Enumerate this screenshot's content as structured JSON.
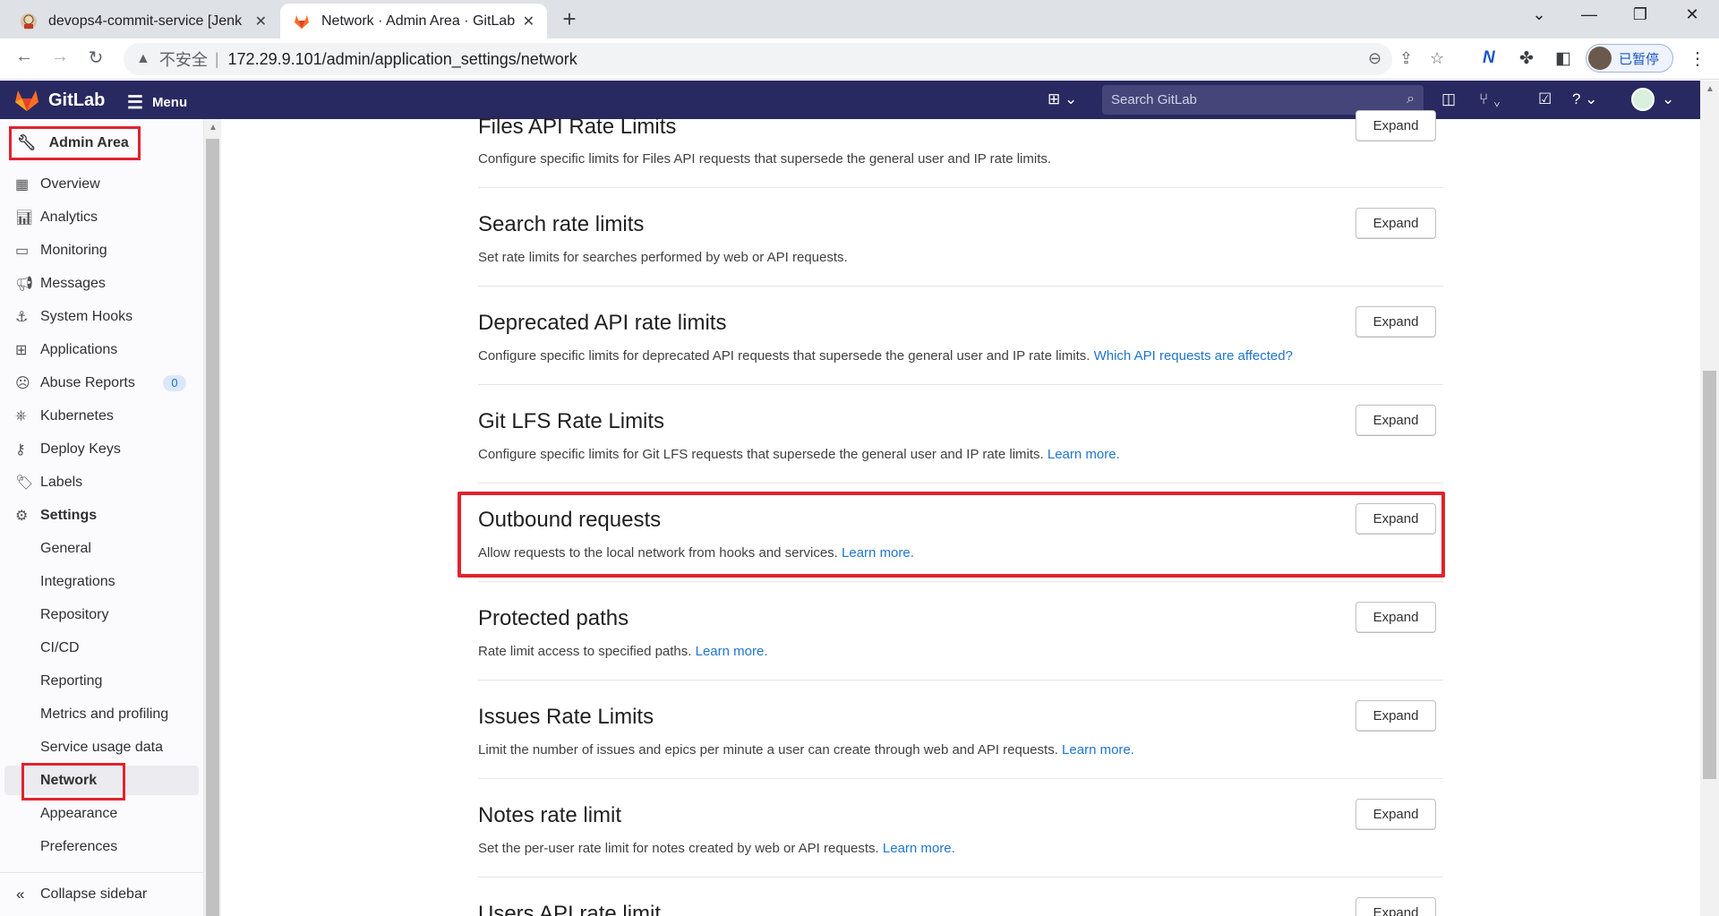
{
  "browser": {
    "tabs": [
      {
        "title": "devops4-commit-service [Jenk",
        "active": false,
        "icon": "jenkins-icon"
      },
      {
        "title": "Network · Admin Area · GitLab",
        "active": true,
        "icon": "gitlab-tanuki-icon"
      }
    ],
    "security_label": "不安全",
    "url": "172.29.9.101/admin/application_settings/network",
    "profile_label": "已暂停"
  },
  "header": {
    "brand": "GitLab",
    "menu_label": "Menu",
    "search_placeholder": "Search GitLab"
  },
  "sidebar": {
    "title": "Admin Area",
    "items": [
      {
        "label": "Overview",
        "icon": "grid-icon"
      },
      {
        "label": "Analytics",
        "icon": "chart-icon"
      },
      {
        "label": "Monitoring",
        "icon": "monitor-icon"
      },
      {
        "label": "Messages",
        "icon": "megaphone-icon"
      },
      {
        "label": "System Hooks",
        "icon": "anchor-icon"
      },
      {
        "label": "Applications",
        "icon": "apps-icon"
      },
      {
        "label": "Abuse Reports",
        "icon": "sad-face-icon",
        "badge": "0"
      },
      {
        "label": "Kubernetes",
        "icon": "kubernetes-icon"
      },
      {
        "label": "Deploy Keys",
        "icon": "key-icon"
      },
      {
        "label": "Labels",
        "icon": "label-icon"
      },
      {
        "label": "Settings",
        "icon": "gear-icon"
      }
    ],
    "settings_items": [
      "General",
      "Integrations",
      "Repository",
      "CI/CD",
      "Reporting",
      "Metrics and profiling",
      "Service usage data",
      "Network",
      "Appearance",
      "Preferences"
    ],
    "collapse_label": "Collapse sidebar"
  },
  "sections": [
    {
      "title": "Files API Rate Limits",
      "desc": "Configure specific limits for Files API requests that supersede the general user and IP rate limits.",
      "link": "",
      "button": "Expand"
    },
    {
      "title": "Search rate limits",
      "desc": "Set rate limits for searches performed by web or API requests.",
      "link": "",
      "button": "Expand"
    },
    {
      "title": "Deprecated API rate limits",
      "desc": "Configure specific limits for deprecated API requests that supersede the general user and IP rate limits.",
      "link": "Which API requests are affected?",
      "button": "Expand"
    },
    {
      "title": "Git LFS Rate Limits",
      "desc": "Configure specific limits for Git LFS requests that supersede the general user and IP rate limits.",
      "link": "Learn more.",
      "button": "Expand"
    },
    {
      "title": "Outbound requests",
      "desc": "Allow requests to the local network from hooks and services.",
      "link": "Learn more.",
      "button": "Expand"
    },
    {
      "title": "Protected paths",
      "desc": "Rate limit access to specified paths.",
      "link": "Learn more.",
      "button": "Expand"
    },
    {
      "title": "Issues Rate Limits",
      "desc": "Limit the number of issues and epics per minute a user can create through web and API requests.",
      "link": "Learn more.",
      "button": "Expand"
    },
    {
      "title": "Notes rate limit",
      "desc": "Set the per-user rate limit for notes created by web or API requests.",
      "link": "Learn more.",
      "button": "Expand"
    },
    {
      "title": "Users API rate limit",
      "desc": "",
      "link": "",
      "button": "Expand"
    }
  ],
  "colors": {
    "header_bg": "#292961",
    "link": "#1f75cb",
    "highlight_box": "#e0232e"
  }
}
